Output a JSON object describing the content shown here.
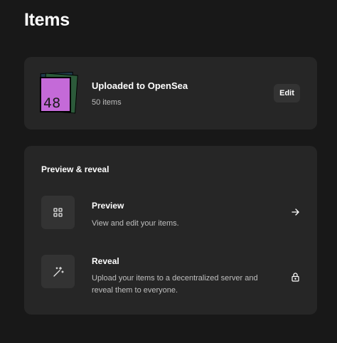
{
  "page": {
    "title": "Items"
  },
  "collection": {
    "title": "Uploaded to OpenSea",
    "subtitle": "50 items",
    "thumbnail_text": "48",
    "edit_label": "Edit"
  },
  "preview_reveal": {
    "section_title": "Preview & reveal",
    "rows": [
      {
        "title": "Preview",
        "description": "View and edit your items.",
        "icon": "grid-icon",
        "action_icon": "arrow-right-icon"
      },
      {
        "title": "Reveal",
        "description": "Upload your items to a decentralized server and reveal them to everyone.",
        "icon": "magic-wand-icon",
        "action_icon": "lock-icon"
      }
    ]
  },
  "colors": {
    "background": "#181818",
    "card": "#262626",
    "button": "#333333",
    "thumbnail": "#c46ad8"
  }
}
